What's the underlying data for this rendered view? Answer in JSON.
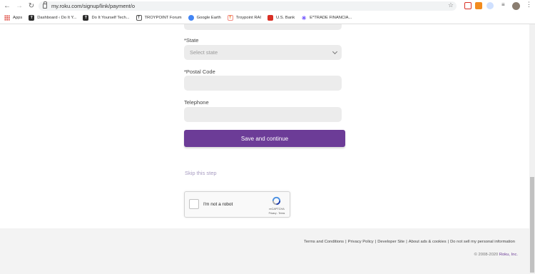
{
  "browser": {
    "url": "my.roku.com/signup/link/payment/o",
    "bookmarks": [
      {
        "label": "Apps",
        "color": "#d93025"
      },
      {
        "label": "Dashboard ‹ Do It Y...",
        "color": "#2b2b2b"
      },
      {
        "label": "Do It Yourself Tech...",
        "color": "#2b2b2b"
      },
      {
        "label": "TROYPOINT Forum",
        "color": "#555555"
      },
      {
        "label": "Google Earth",
        "color": "#4285f4"
      },
      {
        "label": "Troypoint RAI",
        "color": "#f28b82"
      },
      {
        "label": "U.S. Bank",
        "color": "#d93025"
      },
      {
        "label": "E*TRADE FINANCIA...",
        "color": "#6a4cff"
      }
    ]
  },
  "form": {
    "state_label": "*State",
    "state_placeholder": "Select state",
    "postal_label": "*Postal Code",
    "postal_value": "",
    "phone_label": "Telephone",
    "phone_value": "",
    "save_label": "Save and continue",
    "skip_label": "Skip this step"
  },
  "captcha": {
    "label": "I'm not a robot",
    "brand": "reCAPTCHA",
    "terms": "Privacy - Terms"
  },
  "footer": {
    "links": [
      "Terms and Conditions",
      "Privacy Policy",
      "Developer Site",
      "About ads & cookies",
      "Do not sell my personal information"
    ],
    "copyright": "© 2008-2020",
    "brand": "Roku, Inc."
  },
  "colors": {
    "accent": "#6c3c97",
    "field_bg": "#ececec",
    "footer_bg": "#f3f3f3"
  }
}
